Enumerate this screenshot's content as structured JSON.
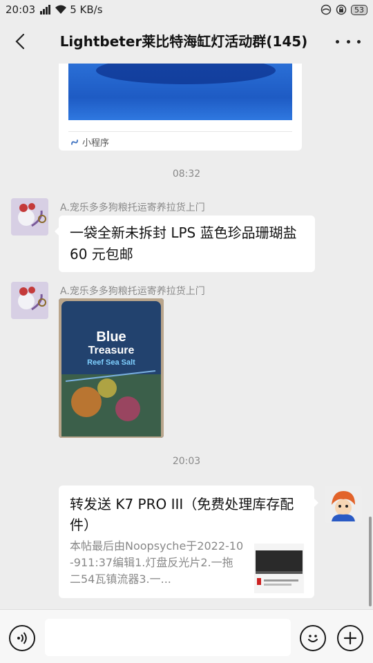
{
  "status_bar": {
    "time": "20:03",
    "network_speed": "5 KB/s",
    "battery": "53",
    "icons": [
      "signal-icon",
      "wifi-icon",
      "alarm-icon",
      "lock-icon",
      "battery-icon"
    ]
  },
  "header": {
    "title": "Lightbeter莱比特海缸灯活动群(145)",
    "icons": [
      "back-arrow-icon",
      "more-dots-icon"
    ]
  },
  "messages": {
    "mini_program": {
      "label": "小程序"
    },
    "timestamp1": "08:32",
    "msg1": {
      "sender": "A.宠乐多多狗粮托运寄养拉货上门",
      "text": "一袋全新未拆封 LPS 蓝色珍品珊瑚盐 60 元包邮"
    },
    "msg2": {
      "sender": "A.宠乐多多狗粮托运寄养拉货上门",
      "photo_text": [
        "Blue",
        "Treasure",
        "Reef Sea Salt"
      ]
    },
    "timestamp2": "20:03",
    "shared_link": {
      "title": "转发送 K7 PRO III（免费处理库存配件）",
      "description": "本帖最后由Noopsyche于2022-10-911:37编辑1.灯盘反光片2.一拖二54瓦镇流器3.一..."
    }
  },
  "input_bar": {
    "placeholder": "",
    "icons": [
      "voice-icon",
      "emoji-icon",
      "plus-icon"
    ]
  },
  "colors": {
    "background": "#ededed",
    "bubble": "#ffffff",
    "muted_text": "#888888"
  }
}
